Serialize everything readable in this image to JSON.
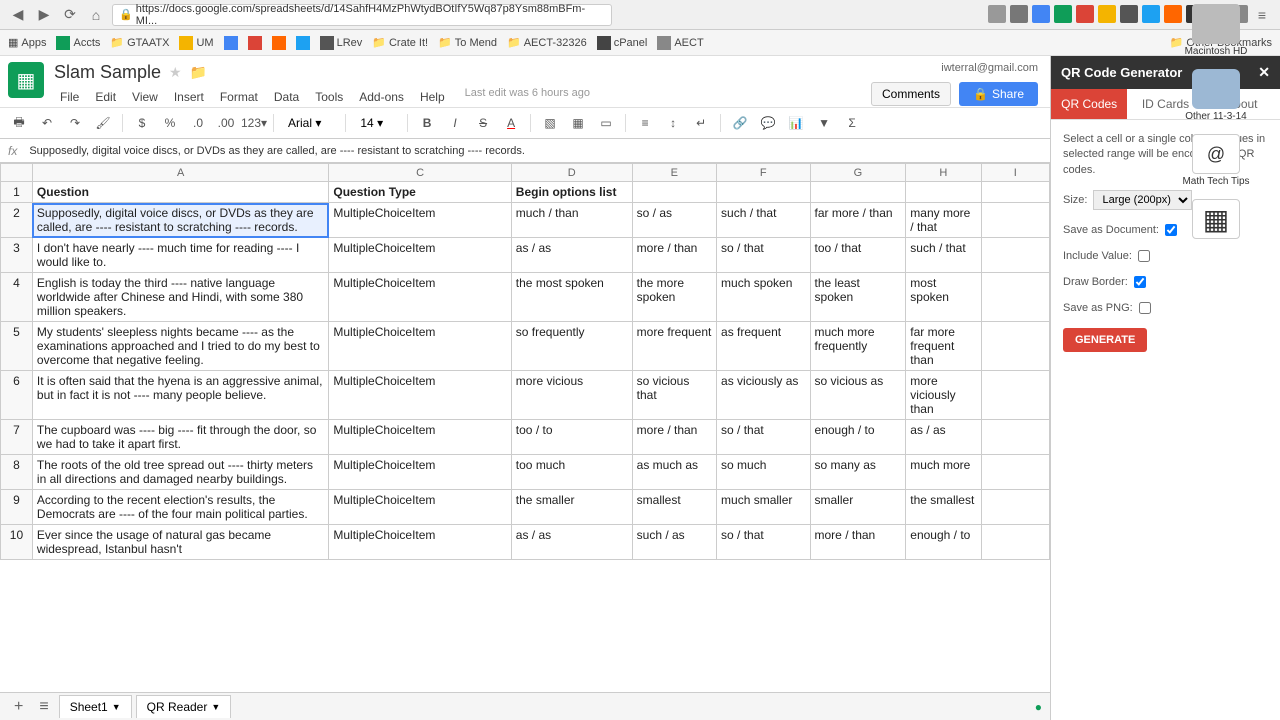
{
  "browser": {
    "url": "https://docs.google.com/spreadsheets/d/14SahfH4MzPhWtydBOtIfY5Wq87p8Ysm88mBFm-MI...",
    "bookmarks": [
      "Apps",
      "Accts",
      "GTAATX",
      "UM",
      "LRev",
      "Crate It!",
      "To Mend",
      "AECT-32326",
      "cPanel",
      "AECT"
    ],
    "other_bookmarks": "Other Bookmarks"
  },
  "doc": {
    "title": "Slam Sample",
    "user_email": "iwterral@gmail.com",
    "last_edit": "Last edit was 6 hours ago",
    "comments_btn": "Comments",
    "share_btn": "Share"
  },
  "menus": [
    "File",
    "Edit",
    "View",
    "Insert",
    "Format",
    "Data",
    "Tools",
    "Add-ons",
    "Help"
  ],
  "toolbar": {
    "font": "Arial",
    "size": "14"
  },
  "formula": {
    "fx": "fx",
    "content": "Supposedly, digital voice discs, or DVDs as they are called, are ---- resistant to scratching ---- records."
  },
  "columns": [
    "",
    "A",
    "C",
    "D",
    "E",
    "F",
    "G",
    "H",
    "I"
  ],
  "headers": {
    "A": "Question",
    "C": "Question Type",
    "D": "Begin options list"
  },
  "rows": [
    {
      "num": "2",
      "A": "Supposedly, digital voice discs, or DVDs as they are called, are ---- resistant to scratching ---- records.",
      "C": "MultipleChoiceItem",
      "D": "much / than",
      "E": "so / as",
      "F": "such / that",
      "G": "far more / than",
      "H": "many more / that"
    },
    {
      "num": "3",
      "A": "I don't have nearly ---- much time for reading ---- I would like to.",
      "C": "MultipleChoiceItem",
      "D": "as / as",
      "E": "more / than",
      "F": "so / that",
      "G": "too / that",
      "H": "such / that"
    },
    {
      "num": "4",
      "A": "English is today the third ---- native language worldwide after Chinese and Hindi, with some 380 million speakers.",
      "C": "MultipleChoiceItem",
      "D": "the most spoken",
      "E": "the more spoken",
      "F": "much spoken",
      "G": "the least spoken",
      "H": "most spoken"
    },
    {
      "num": "5",
      "A": "My students' sleepless nights became ---- as the examinations approached and I tried to do my best to overcome that negative feeling.",
      "C": "MultipleChoiceItem",
      "D": "so frequently",
      "E": "more frequent",
      "F": "as frequent",
      "G": "much more frequently",
      "H": "far more frequent than"
    },
    {
      "num": "6",
      "A": "It is often said that the hyena is an aggressive animal, but in fact it is not ---- many people believe.",
      "C": "MultipleChoiceItem",
      "D": "more vicious",
      "E": "so vicious that",
      "F": "as viciously as",
      "G": "so vicious as",
      "H": "more viciously than"
    },
    {
      "num": "7",
      "A": "The cupboard was ---- big ---- fit through the door, so we had to take it apart first.",
      "C": "MultipleChoiceItem",
      "D": "too / to",
      "E": "more / than",
      "F": "so / that",
      "G": "enough / to",
      "H": "as / as"
    },
    {
      "num": "8",
      "A": "The roots of the old tree spread out ---- thirty meters in all directions and damaged nearby buildings.",
      "C": "MultipleChoiceItem",
      "D": "too much",
      "E": "as much as",
      "F": "so much",
      "G": "so many as",
      "H": "much more"
    },
    {
      "num": "9",
      "A": "According to the recent election's results, the Democrats are ---- of the four main political parties.",
      "C": "MultipleChoiceItem",
      "D": "the smaller",
      "E": "smallest",
      "F": "much smaller",
      "G": "smaller",
      "H": "the smallest"
    },
    {
      "num": "10",
      "A": "Ever since the usage of natural gas became widespread, Istanbul hasn't",
      "C": "MultipleChoiceItem",
      "D": "as / as",
      "E": "such / as",
      "F": "so / that",
      "G": "more / than",
      "H": "enough / to"
    }
  ],
  "sidebar": {
    "title": "QR Code Generator",
    "tabs": [
      "QR Codes",
      "ID Cards",
      "About"
    ],
    "instructions": "Select a cell or a single column. Values in selected range will be encoded into QR codes.",
    "size_label": "Size:",
    "size_value": "Large (200px)",
    "save_doc": "Save as Document:",
    "include_value": "Include Value:",
    "draw_border": "Draw Border:",
    "save_png": "Save as PNG:",
    "generate": "GENERATE"
  },
  "sheet_tabs": [
    "Sheet1",
    "QR Reader"
  ],
  "desktop": {
    "hd": "Macintosh HD",
    "folder": "Other 11-3-14",
    "http": "Math Tech Tips"
  }
}
